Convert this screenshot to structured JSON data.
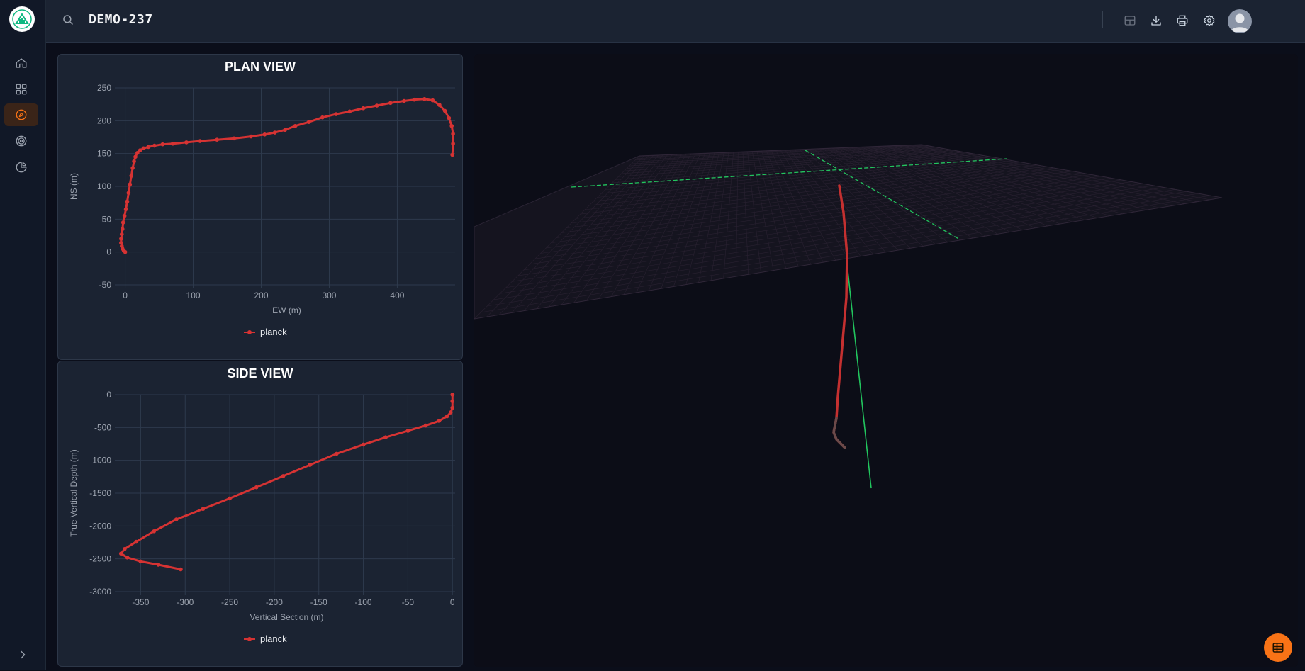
{
  "app": {
    "title": "DEMO-237"
  },
  "topbar": {
    "icons": [
      "search-icon",
      "layout-icon",
      "download-icon",
      "print-icon",
      "gear-icon",
      "user-icon"
    ]
  },
  "sidebar": {
    "items": [
      {
        "icon": "home-icon",
        "active": false
      },
      {
        "icon": "grid-icon",
        "active": false
      },
      {
        "icon": "compass-icon",
        "active": true
      },
      {
        "icon": "target-icon",
        "active": false
      },
      {
        "icon": "pie-chart-icon",
        "active": false
      }
    ],
    "expand_icon": "chevron-right-icon"
  },
  "fab": {
    "icon": "table-icon",
    "color": "#f97316"
  },
  "colors": {
    "accent": "#f97316",
    "series": "#d63333",
    "grid": "#2e3a4d",
    "axis_green": "#22c55e"
  },
  "chart_data": [
    {
      "type": "scatter",
      "title": "PLAN VIEW",
      "xlabel": "EW (m)",
      "ylabel": "NS (m)",
      "xlim": [
        -10,
        485
      ],
      "ylim": [
        -50,
        250
      ],
      "xticks": [
        0,
        100,
        200,
        300,
        400
      ],
      "yticks": [
        -50,
        0,
        50,
        100,
        150,
        200,
        250
      ],
      "grid": true,
      "legend": "bottom-center",
      "series": [
        {
          "name": "planck",
          "color": "#d63333",
          "points": [
            [
              0,
              0
            ],
            [
              -2,
              2
            ],
            [
              -4,
              5
            ],
            [
              -5,
              9
            ],
            [
              -6,
              14
            ],
            [
              -6,
              20
            ],
            [
              -5,
              27
            ],
            [
              -4,
              35
            ],
            [
              -3,
              45
            ],
            [
              -1,
              55
            ],
            [
              1,
              65
            ],
            [
              3,
              77
            ],
            [
              5,
              90
            ],
            [
              7,
              103
            ],
            [
              9,
              116
            ],
            [
              11,
              128
            ],
            [
              13,
              138
            ],
            [
              15,
              145
            ],
            [
              18,
              151
            ],
            [
              22,
              155
            ],
            [
              27,
              158
            ],
            [
              34,
              160
            ],
            [
              43,
              162
            ],
            [
              55,
              164
            ],
            [
              70,
              165
            ],
            [
              90,
              167
            ],
            [
              110,
              169
            ],
            [
              135,
              171
            ],
            [
              160,
              173
            ],
            [
              185,
              176
            ],
            [
              205,
              179
            ],
            [
              220,
              182
            ],
            [
              235,
              186
            ],
            [
              250,
              192
            ],
            [
              270,
              198
            ],
            [
              290,
              205
            ],
            [
              310,
              210
            ],
            [
              330,
              214
            ],
            [
              350,
              219
            ],
            [
              370,
              223
            ],
            [
              390,
              227
            ],
            [
              410,
              230
            ],
            [
              425,
              232
            ],
            [
              440,
              233
            ],
            [
              452,
              231
            ],
            [
              462,
              224
            ],
            [
              470,
              215
            ],
            [
              476,
              204
            ],
            [
              480,
              192
            ],
            [
              482,
              180
            ],
            [
              482,
              165
            ],
            [
              481,
              148
            ]
          ]
        }
      ]
    },
    {
      "type": "scatter",
      "title": "SIDE VIEW",
      "xlabel": "Vertical Section (m)",
      "ylabel": "True Vertical Depth (m)",
      "xlim": [
        -375,
        3
      ],
      "ylim": [
        -3000,
        0
      ],
      "xticks": [
        -350,
        -300,
        -250,
        -200,
        -150,
        -100,
        -50,
        0
      ],
      "yticks": [
        0,
        -500,
        -1000,
        -1500,
        -2000,
        -2500,
        -3000
      ],
      "grid": true,
      "legend": "bottom-center",
      "series": [
        {
          "name": "planck",
          "color": "#d63333",
          "points": [
            [
              0,
              0
            ],
            [
              0,
              -100
            ],
            [
              0,
              -200
            ],
            [
              -2,
              -270
            ],
            [
              -6,
              -330
            ],
            [
              -15,
              -400
            ],
            [
              -30,
              -470
            ],
            [
              -50,
              -550
            ],
            [
              -75,
              -650
            ],
            [
              -100,
              -760
            ],
            [
              -130,
              -900
            ],
            [
              -160,
              -1070
            ],
            [
              -190,
              -1240
            ],
            [
              -220,
              -1410
            ],
            [
              -250,
              -1580
            ],
            [
              -280,
              -1740
            ],
            [
              -310,
              -1900
            ],
            [
              -335,
              -2080
            ],
            [
              -355,
              -2240
            ],
            [
              -368,
              -2350
            ],
            [
              -372,
              -2420
            ],
            [
              -365,
              -2480
            ],
            [
              -350,
              -2540
            ],
            [
              -330,
              -2590
            ],
            [
              -305,
              -2660
            ]
          ]
        }
      ]
    }
  ]
}
